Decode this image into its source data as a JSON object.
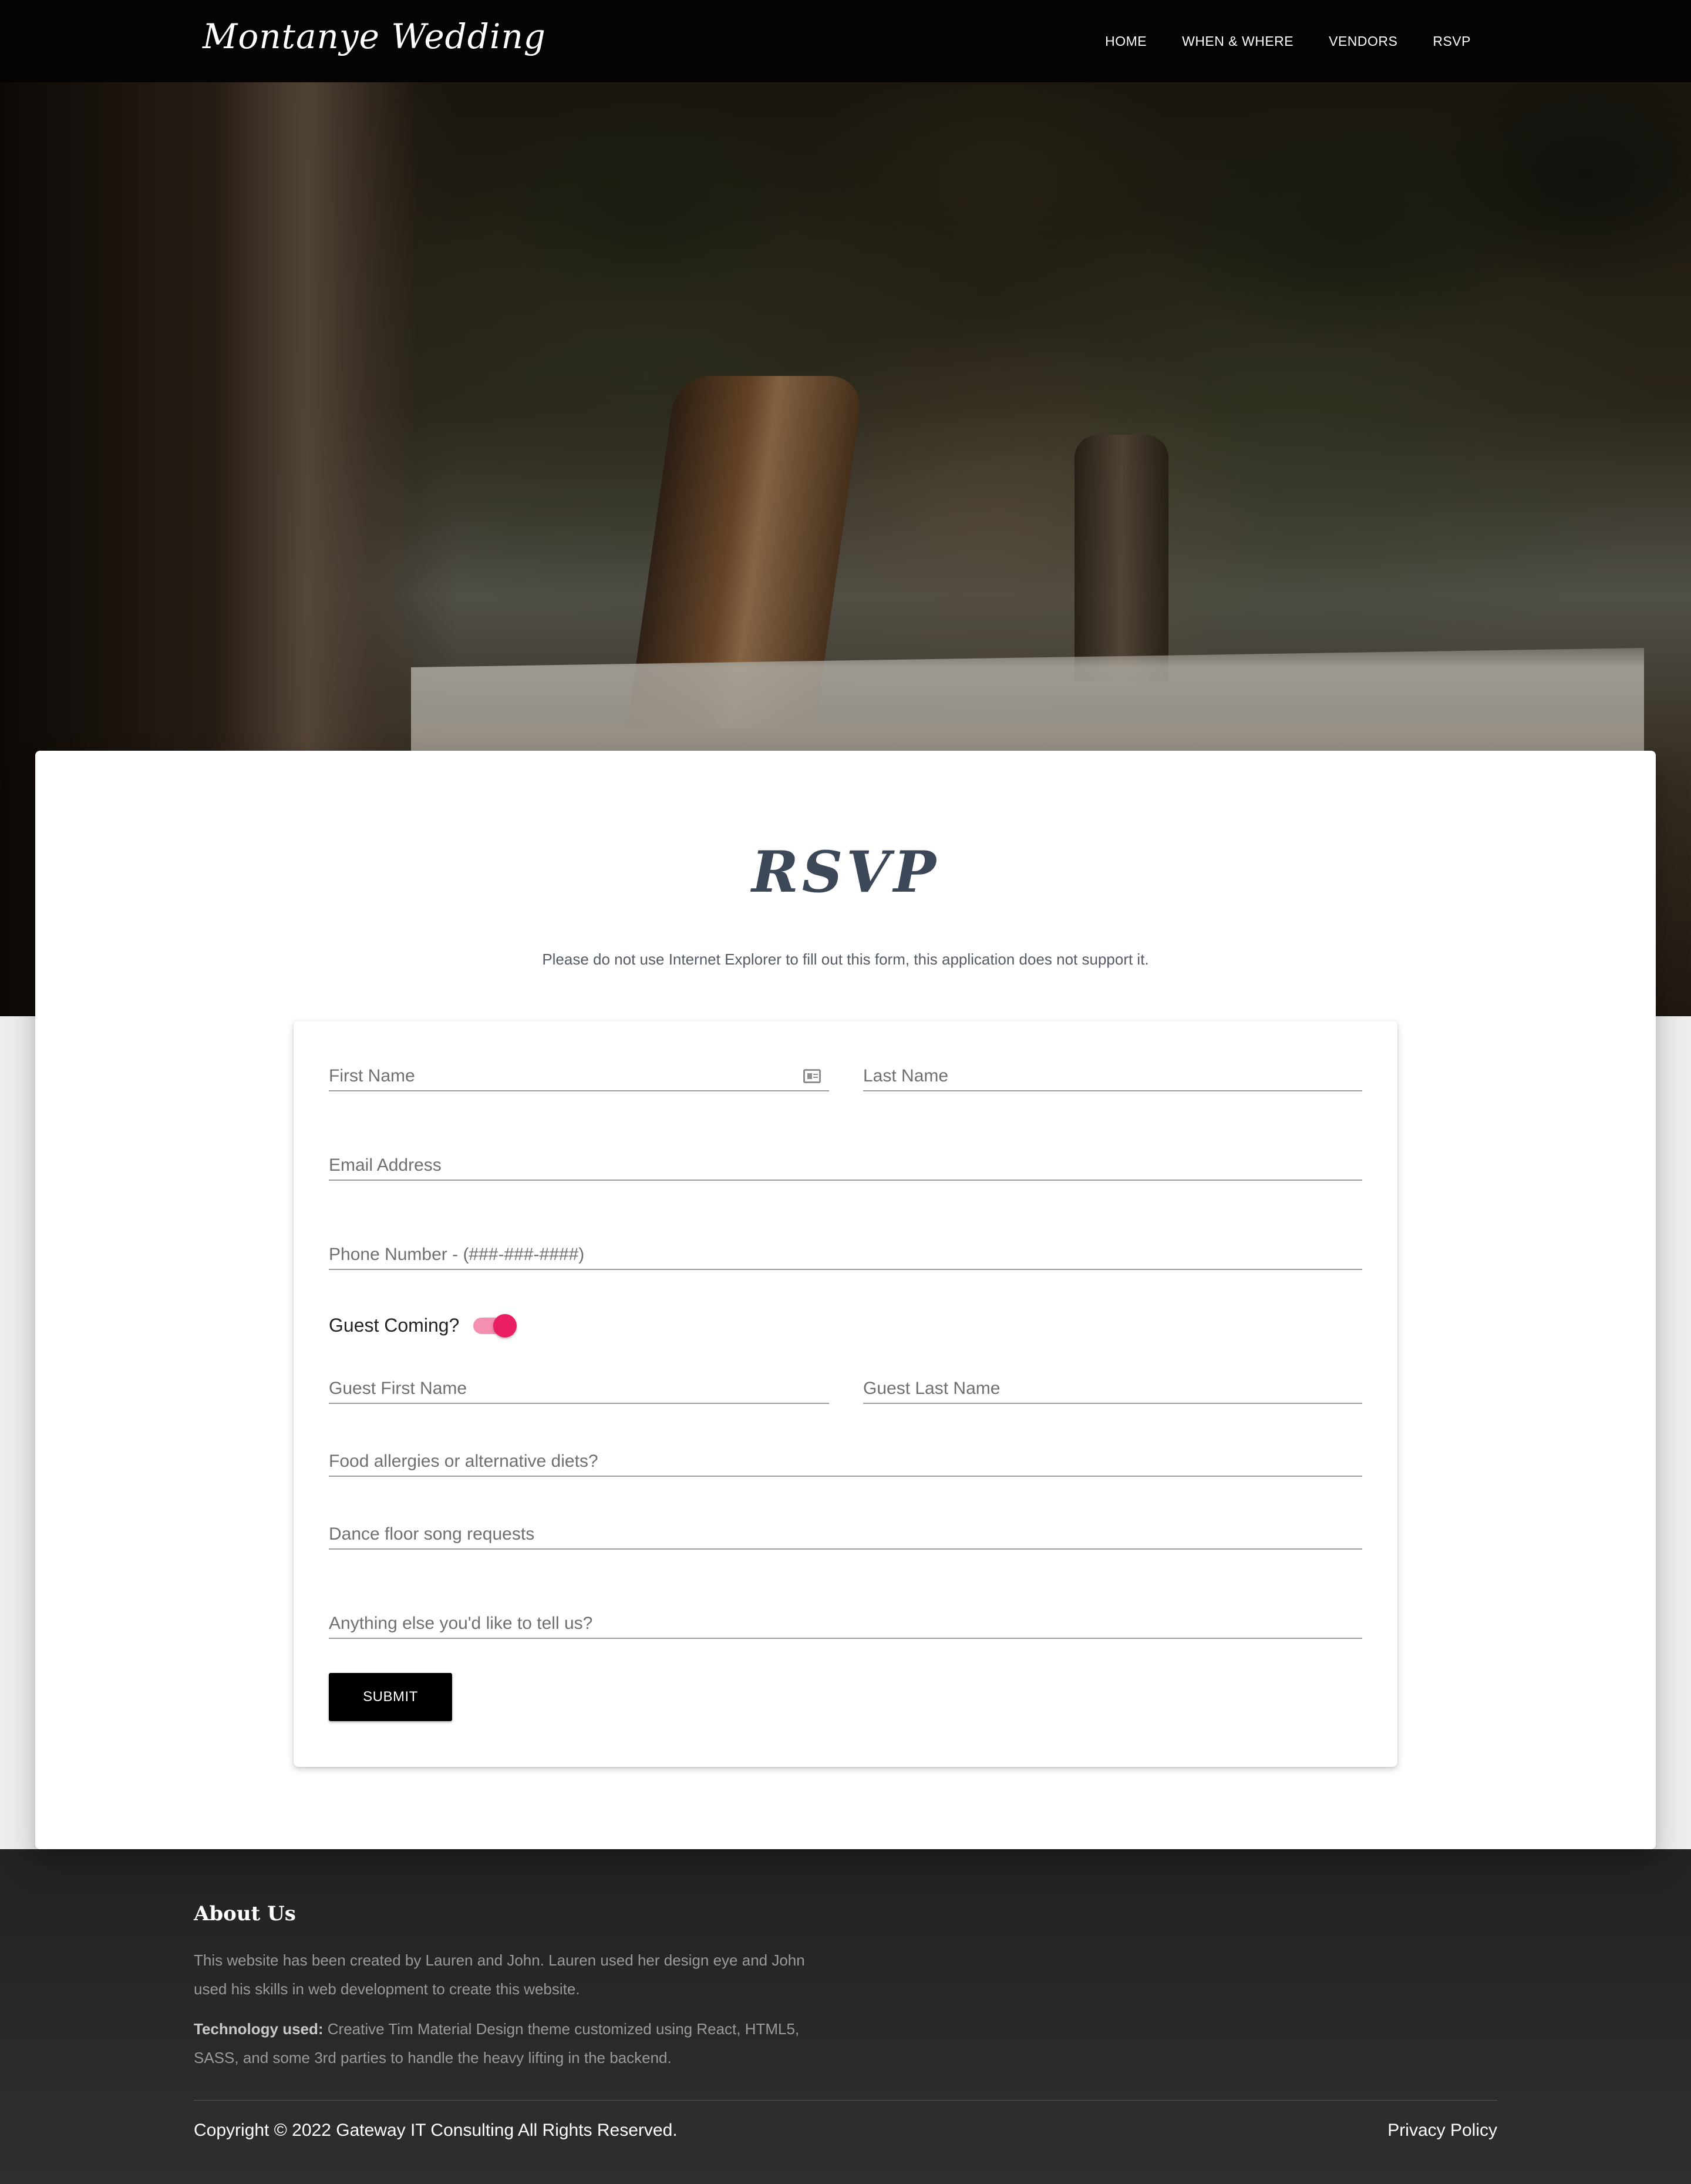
{
  "navbar": {
    "brand": "Montanye Wedding",
    "links": [
      "HOME",
      "WHEN & WHERE",
      "VENDORS",
      "RSVP"
    ]
  },
  "hero": {
    "image": "outdoor wedding reception tables under trees"
  },
  "rsvp": {
    "title": "RSVP",
    "note": "Please do not use Internet Explorer to fill out this form, this application does not support it."
  },
  "form": {
    "first_name_placeholder": "First Name",
    "last_name_placeholder": "Last Name",
    "email_placeholder": "Email Address",
    "phone_placeholder": "Phone Number - (###-###-####)",
    "guest_toggle_label": "Guest Coming?",
    "guest_toggle_on": true,
    "guest_first_name_placeholder": "Guest First Name",
    "guest_last_name_placeholder": "Guest Last Name",
    "allergies_placeholder": "Food allergies or alternative diets?",
    "songs_placeholder": "Dance floor song requests",
    "other_placeholder": "Anything else you'd like to tell us?",
    "submit_label": "SUBMIT",
    "accent_color": "#e91e63"
  },
  "footer": {
    "about_title": "About Us",
    "about_text": "This website has been created by Lauren and John. Lauren used her design eye and John used his skills in web development to create this website.",
    "tech_label": "Technology used:",
    "tech_text": " Creative Tim Material Design theme customized using React, HTML5, SASS, and some 3rd parties to handle the heavy lifting in the backend.",
    "copyright": "Copyright © 2022 Gateway IT Consulting All Rights Reserved.",
    "privacy_label": "Privacy Policy"
  }
}
